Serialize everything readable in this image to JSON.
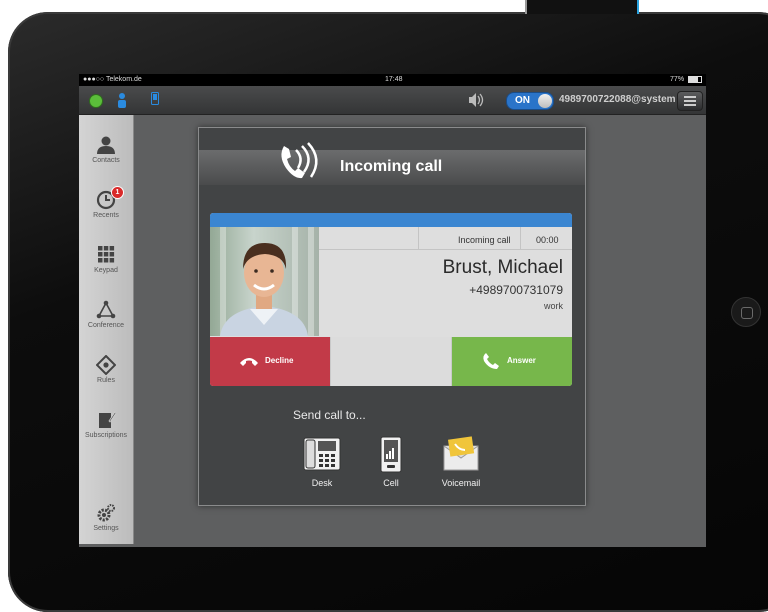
{
  "status_bar": {
    "carrier": "●●●○○ Telekom.de",
    "time": "17:48",
    "battery": "77%",
    "battery_level": 0.77
  },
  "top_bar": {
    "toggle_label": "ON",
    "account": "4989700722088@system"
  },
  "sidebar": {
    "items": [
      {
        "label": "Contacts",
        "icon": "contacts-icon"
      },
      {
        "label": "Recents",
        "icon": "clock-icon",
        "badge": "1"
      },
      {
        "label": "Keypad",
        "icon": "keypad-icon"
      },
      {
        "label": "Conference",
        "icon": "conference-icon"
      },
      {
        "label": "Rules",
        "icon": "rules-icon"
      },
      {
        "label": "Subscriptions",
        "icon": "subscriptions-icon"
      },
      {
        "label": "Settings",
        "icon": "gear-icon"
      }
    ]
  },
  "dialog": {
    "title": "Incoming call",
    "card": {
      "status": "Incoming call",
      "timer": "00:00",
      "name": "Brust, Michael",
      "number": "+4989700731079",
      "number_type": "work"
    },
    "decline_label": "Decline",
    "answer_label": "Answer",
    "send_to_label": "Send call to...",
    "targets": [
      {
        "label": "Desk",
        "icon": "desk-phone-icon"
      },
      {
        "label": "Cell",
        "icon": "cell-phone-icon"
      },
      {
        "label": "Voicemail",
        "icon": "voicemail-icon"
      }
    ]
  },
  "colors": {
    "accent_blue": "#3b86d1",
    "decline_red": "#c23a48",
    "answer_green": "#77b74b",
    "presence_green": "#5bbd3a"
  }
}
